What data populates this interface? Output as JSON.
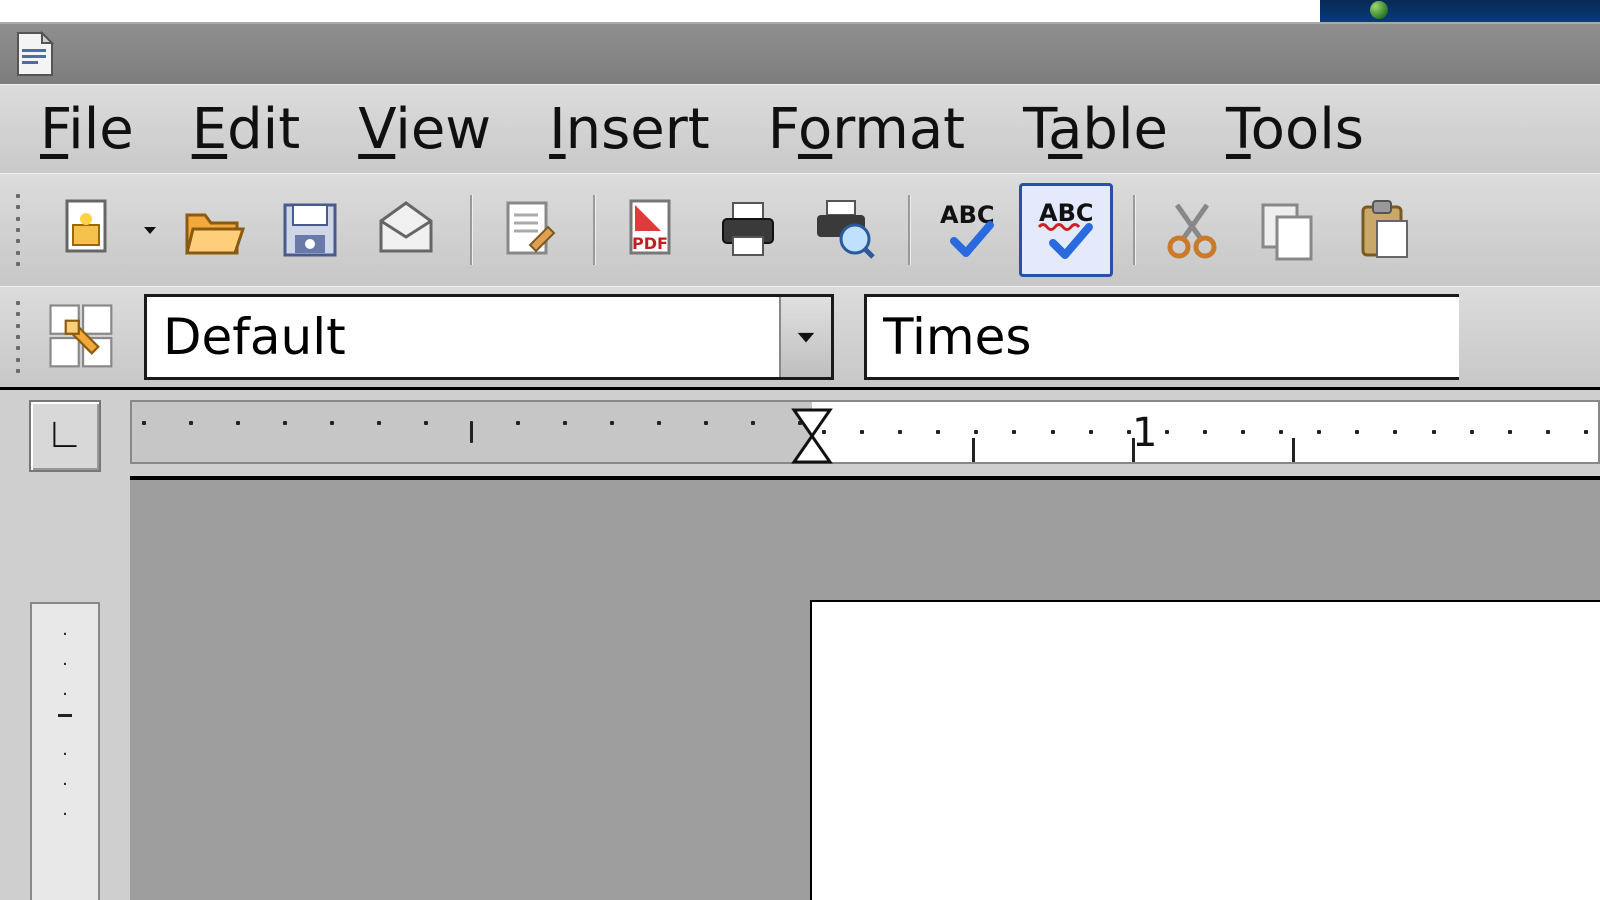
{
  "menu": {
    "file": "File",
    "edit": "Edit",
    "view": "View",
    "insert": "Insert",
    "format": "Format",
    "table": "Table",
    "tools": "Tools"
  },
  "toolbar_icons": {
    "new": "new-document-icon",
    "open": "open-folder-icon",
    "save": "save-floppy-icon",
    "mail": "mail-envelope-icon",
    "edit_file": "edit-document-icon",
    "export_pdf": "export-pdf-icon",
    "print": "printer-icon",
    "print_preview": "print-preview-icon",
    "spellcheck": "spellcheck-icon",
    "autospellcheck": "auto-spellcheck-icon",
    "cut": "cut-scissors-icon",
    "copy": "copy-icon",
    "paste": "paste-clipboard-icon"
  },
  "spellcheck_label": "ABC",
  "pdf_label": "PDF",
  "format_toolbar": {
    "paragraph_style": "Default",
    "font_name": "Times"
  },
  "ruler": {
    "tab_stop_glyph": "L",
    "hmarks": [
      "1"
    ]
  }
}
